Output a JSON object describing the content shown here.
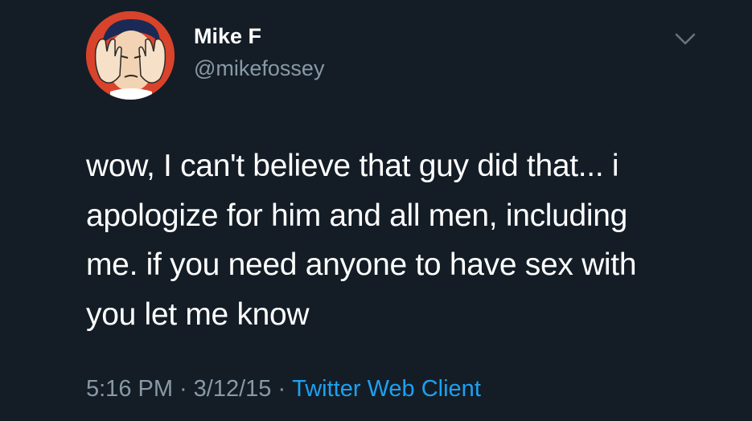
{
  "tweet": {
    "display_name": "Mike F",
    "handle": "@mikefossey",
    "text_lines": [
      "wow, I can't believe that guy did that... i",
      "apologize for him and all men, including",
      "me. if you need anyone to have sex with",
      "you let me know"
    ],
    "time": "5:16 PM",
    "date": "3/12/15",
    "separator": "·",
    "client": "Twitter Web Client"
  },
  "icons": {
    "menu": "chevron-down-icon",
    "avatar": "facepalm-comic-avatar"
  },
  "colors": {
    "background": "#141d26",
    "primary_text": "#ffffff",
    "secondary_text": "#8899a6",
    "link": "#1da1f2",
    "avatar_background": "#d9432b"
  }
}
